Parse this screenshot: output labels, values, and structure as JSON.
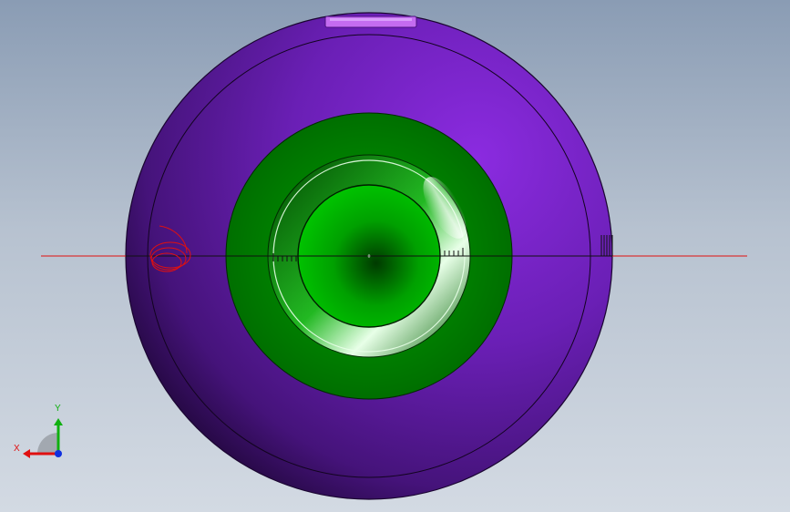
{
  "viewport": {
    "background_top": "#8a9cb4",
    "background_bottom": "#d3dae3"
  },
  "model": {
    "outer_sphere_color": "#6a1fb5",
    "inner_insert_color": "#007a00",
    "section_line_color": "#e01010",
    "highlight_tab_color": "#c46cf0"
  },
  "triad": {
    "x_label": "X",
    "y_label": "Y",
    "x_color": "#e01010",
    "y_color": "#10b010",
    "z_color": "#1030e0"
  }
}
